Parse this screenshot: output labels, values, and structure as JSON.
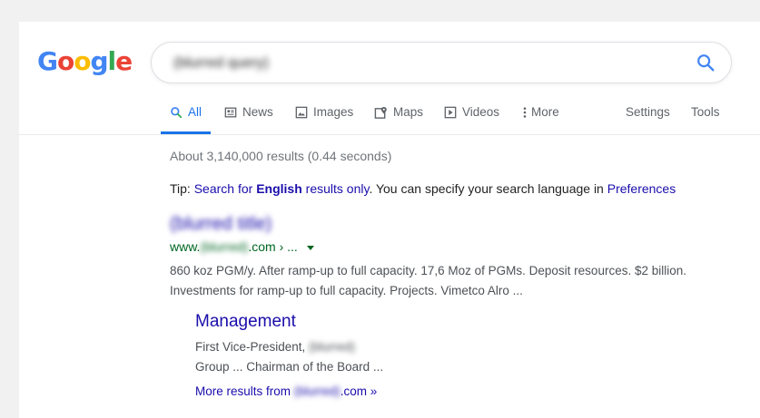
{
  "logo": {
    "letters": [
      "G",
      "o",
      "o",
      "g",
      "l",
      "e"
    ]
  },
  "search": {
    "value": "(blurred query)",
    "button_icon": "search-icon"
  },
  "tabs": [
    {
      "label": "All",
      "icon": "search-icon",
      "active": true
    },
    {
      "label": "News",
      "icon": "news-icon"
    },
    {
      "label": "Images",
      "icon": "image-icon"
    },
    {
      "label": "Maps",
      "icon": "map-pin-icon"
    },
    {
      "label": "Videos",
      "icon": "play-icon"
    },
    {
      "label": "More",
      "icon": "vertical-dots-icon"
    }
  ],
  "tools": {
    "settings": "Settings",
    "tools": "Tools"
  },
  "stats": "About 3,140,000 results (0.44 seconds)",
  "tip": {
    "prefix": "Tip: ",
    "link1": "Search for ",
    "bold": "English",
    "link2": " results only",
    "mid": ". You can specify your search language in ",
    "link3": "Preferences"
  },
  "result": {
    "title": "(blurred title)",
    "url_prefix": "www.",
    "url_domain": "(blurred)",
    "url_suffix": ".com › ...",
    "snippet": "860 koz PGM/y. After ramp-up to full capacity. 17,6 Moz of PGMs. Deposit resources. $2 billion. Investments for ramp-up to full capacity. Projects. Vimetco Alro ..."
  },
  "sublink": {
    "title": "Management",
    "line1_prefix": "First Vice-President, ",
    "line1_blurred": "(blurred)",
    "line2": "Group ... Chairman of the Board ...",
    "more_prefix": "More results from ",
    "more_blurred": "(blurred)",
    "more_suffix": ".com »"
  },
  "colors": {
    "link": "#1a0dab",
    "url_green": "#006621",
    "accent_blue": "#1a73e8"
  }
}
